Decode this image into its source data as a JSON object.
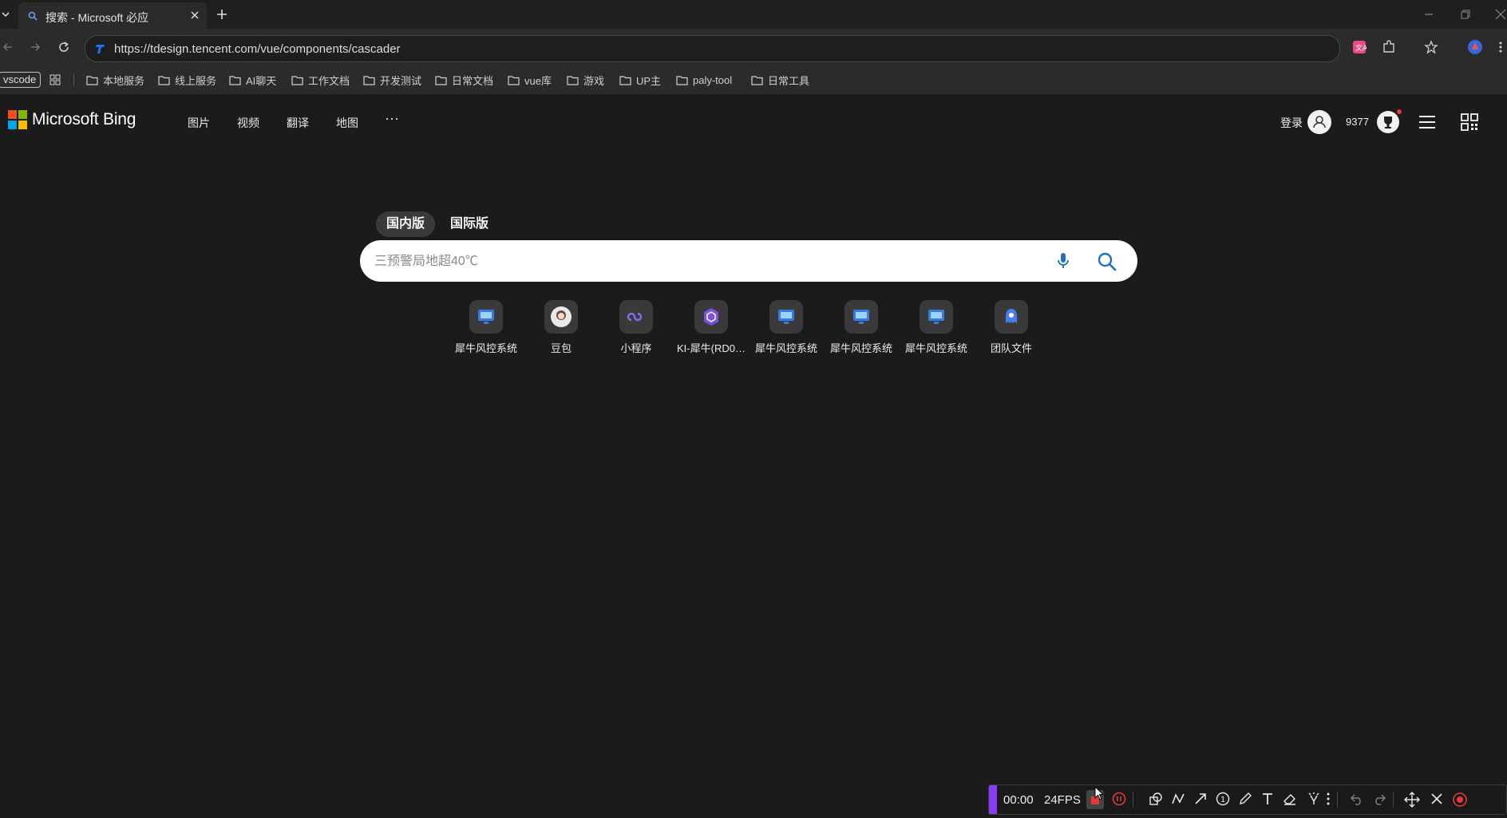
{
  "browser": {
    "tab_title": "搜索 - Microsoft 必应",
    "url": "https://tdesign.tencent.com/vue/components/cascader",
    "bookmarks": [
      {
        "label": "vscode"
      },
      {
        "label": "本地服务"
      },
      {
        "label": "线上服务"
      },
      {
        "label": "AI聊天"
      },
      {
        "label": "工作文档"
      },
      {
        "label": "开发测试"
      },
      {
        "label": "日常文档"
      },
      {
        "label": "vue库"
      },
      {
        "label": "游戏"
      },
      {
        "label": "UP主"
      },
      {
        "label": "paly-tool"
      },
      {
        "label": "日常工具"
      }
    ]
  },
  "header": {
    "brand": "Microsoft Bing",
    "nav": [
      "图片",
      "视频",
      "翻译",
      "地图"
    ],
    "more": "···",
    "signin": "登录",
    "points": "9377"
  },
  "search": {
    "scopes": [
      "国内版",
      "国际版"
    ],
    "active_scope": "国内版",
    "placeholder": "三预警局地超40℃"
  },
  "quick_links": [
    {
      "label": "犀牛风控系统",
      "icon": "rhino-monitor-icon"
    },
    {
      "label": "豆包",
      "icon": "doubao-avatar-icon"
    },
    {
      "label": "小程序",
      "icon": "mini-program-icon"
    },
    {
      "label": "KI-犀牛(RD0…",
      "icon": "ki-hexagon-icon"
    },
    {
      "label": "犀牛风控系统",
      "icon": "rhino-monitor-icon"
    },
    {
      "label": "犀牛风控系统",
      "icon": "rhino-monitor-icon"
    },
    {
      "label": "犀牛风控系统",
      "icon": "rhino-monitor-icon"
    },
    {
      "label": "团队文件",
      "icon": "team-files-icon"
    }
  ],
  "recorder": {
    "time": "00:00",
    "fps": "24FPS"
  },
  "colors": {
    "page_bg": "#1b1b1b",
    "recorder_accent": "#8a3cf5",
    "record_red": "#e23b3b"
  }
}
